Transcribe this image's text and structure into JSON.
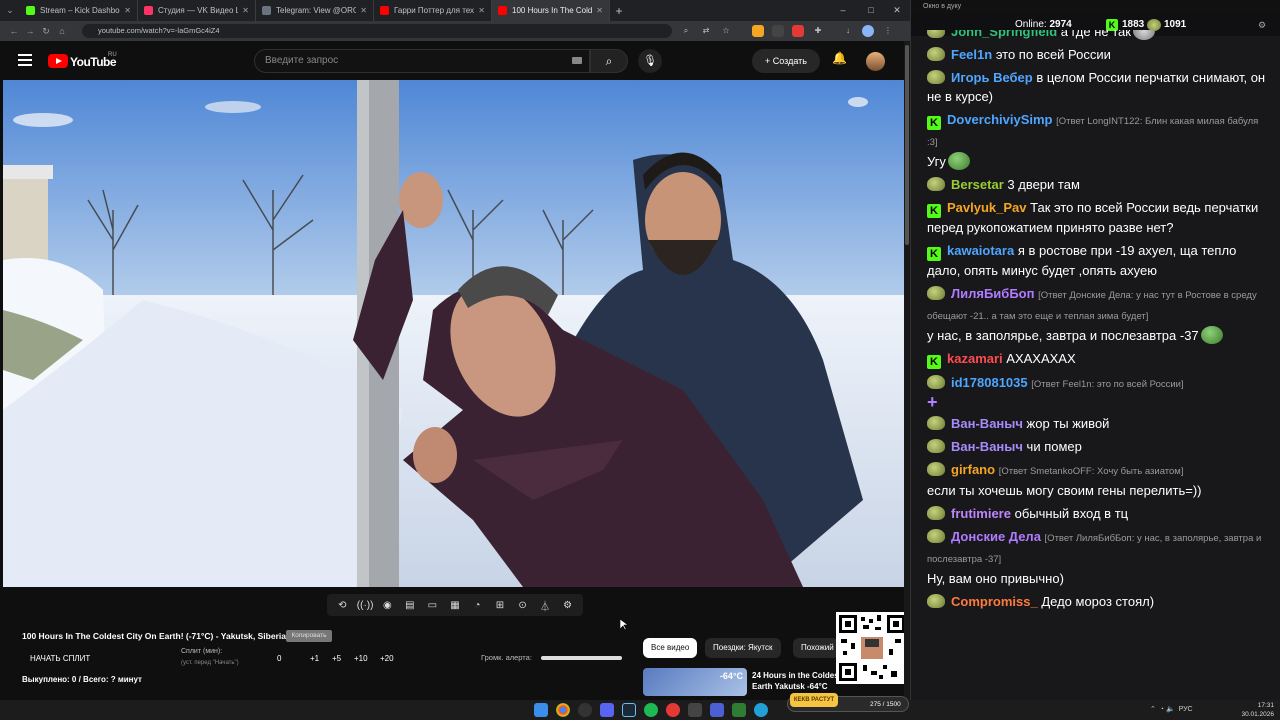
{
  "browser": {
    "tabs": [
      {
        "title": "Stream – Kick Dashboard",
        "fav_color": "#53fc18"
      },
      {
        "title": "Студия — VK Видео Live",
        "fav_color": "#ff3366"
      },
      {
        "title": "Telegram: View @ORGINALDA...",
        "fav_color": "#6b7280"
      },
      {
        "title": "Гарри Поттер для тех, кто вы...",
        "fav_color": "#ff0000"
      },
      {
        "title": "100 Hours In The Coldest C...",
        "fav_color": "#ff0000"
      }
    ],
    "new_tab": "+",
    "url": "youtube.com/watch?v=-laGmGc4iZ4",
    "win_min": "–",
    "win_max": "□",
    "win_close": "✕"
  },
  "youtube": {
    "logo_text": "YouTube",
    "region": "RU",
    "search_placeholder": "Введите запрос",
    "create_label": "Создать",
    "video": {
      "title": "100 Hours In The Coldest City On Earth! (-71°C) - Yakutsk, Siberia",
      "badge": "Копировать"
    },
    "split": {
      "start_label": "НАЧАТЬ СПЛИТ",
      "split_label": "Сплит (мин):",
      "split_hint": "(уст. перед \"Начать\")",
      "values": [
        "0",
        "+1",
        "+5",
        "+10",
        "+20"
      ],
      "bought": "Выкуплено: 0 / Всего: ? минут"
    },
    "alert_label": "Громк. алерта:",
    "alert_volume": 1.0,
    "chips": [
      {
        "label": "Все видео",
        "active": true
      },
      {
        "label": "Поездки: Якутск",
        "active": false
      },
      {
        "label": "Похожий",
        "active": false
      }
    ],
    "recommended": {
      "duration": "-64°C",
      "title": "24 Hours in the Coldest Earth Yakutsk -64°C (-83°F)"
    }
  },
  "chat": {
    "window_title": "Окно в дуку",
    "online_label": "Online:",
    "online_count": "2974",
    "kick_count": "1883",
    "frog_count": "1091",
    "messages": [
      {
        "icon": "frog",
        "user": "John_Springfield",
        "color": "#2ec57a",
        "reply": "",
        "text": "а где не так",
        "emote": "cat"
      },
      {
        "icon": "frog",
        "user": "Feel1n",
        "color": "#4ea6ff",
        "reply": "",
        "text": "это по всей России",
        "emote": ""
      },
      {
        "icon": "frog",
        "user": "Игорь Вебер",
        "color": "#4ea6ff",
        "reply": "",
        "text": "в целом России перчатки снимают, он не в курсе)",
        "emote": ""
      },
      {
        "icon": "kick",
        "user": "DoverchiviySimp",
        "color": "#4ea6ff",
        "reply": "[Ответ LongINT122: Блин какая милая бабуля :3]",
        "text": "Угу",
        "emote": "frog"
      },
      {
        "icon": "frog",
        "user": "Bersetar",
        "color": "#9acd32",
        "reply": "",
        "text": "3 двери там",
        "emote": ""
      },
      {
        "icon": "kick",
        "user": "Pavlyuk_Pav",
        "color": "#f5a623",
        "reply": "",
        "text": "Так это по всей России ведь перчатки перед рукопожатием принято разве нет?",
        "emote": ""
      },
      {
        "icon": "kick",
        "user": "kawaiotara",
        "color": "#4ea6ff",
        "reply": "",
        "text": "я в ростове при -19 ахуел, ща тепло дало, опять минус будет ,опять ахуею",
        "emote": ""
      },
      {
        "icon": "frog",
        "user": "ЛиляБибБоп",
        "color": "#b07cff",
        "reply": "[Ответ Донские Дела: у нас тут в Ростове в среду обещают -21.. а там это еще и теплая зима будет]",
        "text": "у нас, в заполярье, завтра и послезавтра -37",
        "emote": "frog"
      },
      {
        "icon": "kick",
        "user": "kazamari",
        "color": "#ff4d4d",
        "reply": "",
        "text": "АХАХАХАХ",
        "emote": ""
      },
      {
        "icon": "frog",
        "user": "id178081035",
        "color": "#4ea6ff",
        "reply": "[Ответ Feel1n: это по всей России]",
        "text": "",
        "emote": "plus"
      },
      {
        "icon": "frog",
        "user": "Ван-Ваныч",
        "color": "#a78bfa",
        "reply": "",
        "text": "жор ты живой",
        "emote": ""
      },
      {
        "icon": "frog",
        "user": "Ван-Ваныч",
        "color": "#a78bfa",
        "reply": "",
        "text": "чи помер",
        "emote": ""
      },
      {
        "icon": "frog",
        "user": "girfano",
        "color": "#f5a623",
        "reply": "[Ответ SmetankoOFF: Хочу быть азиатом]",
        "text": "если ты хочешь могу своим гены перелить=))",
        "emote": ""
      },
      {
        "icon": "frog",
        "user": "frutimiere",
        "color": "#c084fc",
        "reply": "",
        "text": "обычный вход в тц",
        "emote": ""
      },
      {
        "icon": "frog",
        "user": "Донские Дела",
        "color": "#b07cff",
        "reply": "[Ответ ЛиляБибБоп: у нас, в заполярье, завтра и послезавтра -37]",
        "text": "Ну, вам оно привычно)",
        "emote": ""
      },
      {
        "icon": "frog",
        "user": "Compromiss_",
        "color": "#ff7a3d",
        "reply": "",
        "text": "Дедо мороз стоял)",
        "emote": ""
      }
    ]
  },
  "taskbar": {
    "lang": "РУС",
    "time": "17:31",
    "date": "30.01.2026",
    "points_label": "КЕКВ РАСТУТ",
    "points": "275 / 1500"
  }
}
